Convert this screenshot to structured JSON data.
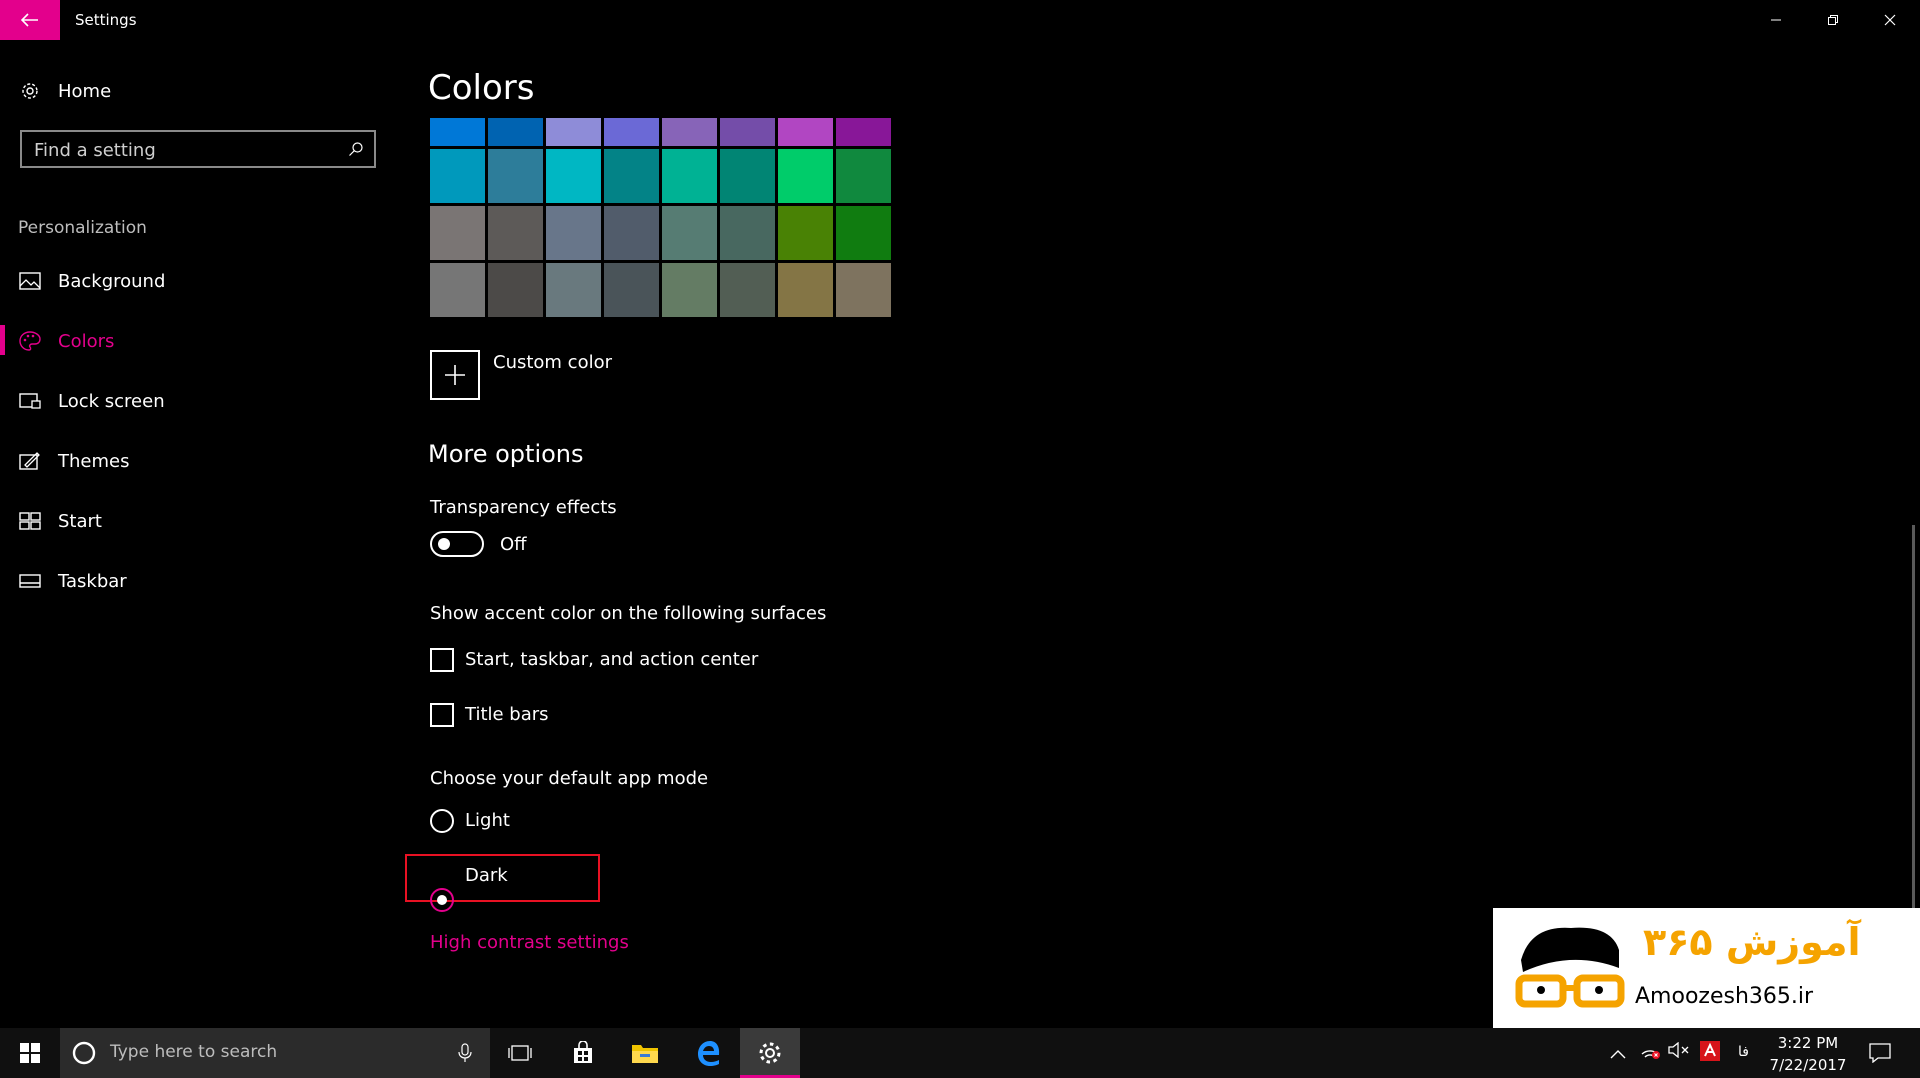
{
  "titlebar": {
    "title": "Settings"
  },
  "sidebar": {
    "home_label": "Home",
    "search_placeholder": "Find a setting",
    "section_label": "Personalization",
    "items": [
      {
        "label": "Background",
        "icon": "picture-icon"
      },
      {
        "label": "Colors",
        "icon": "palette-icon",
        "active": true
      },
      {
        "label": "Lock screen",
        "icon": "lock-screen-icon"
      },
      {
        "label": "Themes",
        "icon": "themes-icon"
      },
      {
        "label": "Start",
        "icon": "start-grid-icon"
      },
      {
        "label": "Taskbar",
        "icon": "taskbar-icon"
      }
    ]
  },
  "main": {
    "title": "Colors",
    "swatches": [
      "#0078d7",
      "#0063b1",
      "#8e8cd8",
      "#6b69d6",
      "#8764b8",
      "#744da9",
      "#b146c2",
      "#881798",
      "#0099bc",
      "#2d7d9a",
      "#00b7c3",
      "#038387",
      "#00b294",
      "#018574",
      "#00cc6a",
      "#10893e",
      "#7a7574",
      "#5d5a58",
      "#68768a",
      "#515c6b",
      "#567c73",
      "#486860",
      "#498205",
      "#107c10",
      "#767676",
      "#4c4a48",
      "#69797e",
      "#4a5459",
      "#647c64",
      "#525e54",
      "#847545",
      "#7e735f"
    ],
    "custom_color_label": "Custom color",
    "more_options_heading": "More options",
    "transparency": {
      "label": "Transparency effects",
      "state": "Off"
    },
    "accent_surfaces": {
      "heading": "Show accent color on the following surfaces",
      "options": [
        {
          "label": "Start, taskbar, and action center",
          "checked": false
        },
        {
          "label": "Title bars",
          "checked": false
        }
      ]
    },
    "app_mode": {
      "heading": "Choose your default app mode",
      "options": [
        {
          "label": "Light",
          "selected": false
        },
        {
          "label": "Dark",
          "selected": true
        }
      ]
    },
    "high_contrast_link": "High contrast settings"
  },
  "watermark": {
    "text": "Amoozesh365.ir",
    "persian": "آموزش ۳۶۵"
  },
  "taskbar": {
    "search_placeholder": "Type here to search",
    "ime_label": "فا",
    "time": "3:22 PM",
    "date": "7/22/2017"
  },
  "colors": {
    "accent": "#e3008c",
    "highlight_box": "#e81123"
  }
}
